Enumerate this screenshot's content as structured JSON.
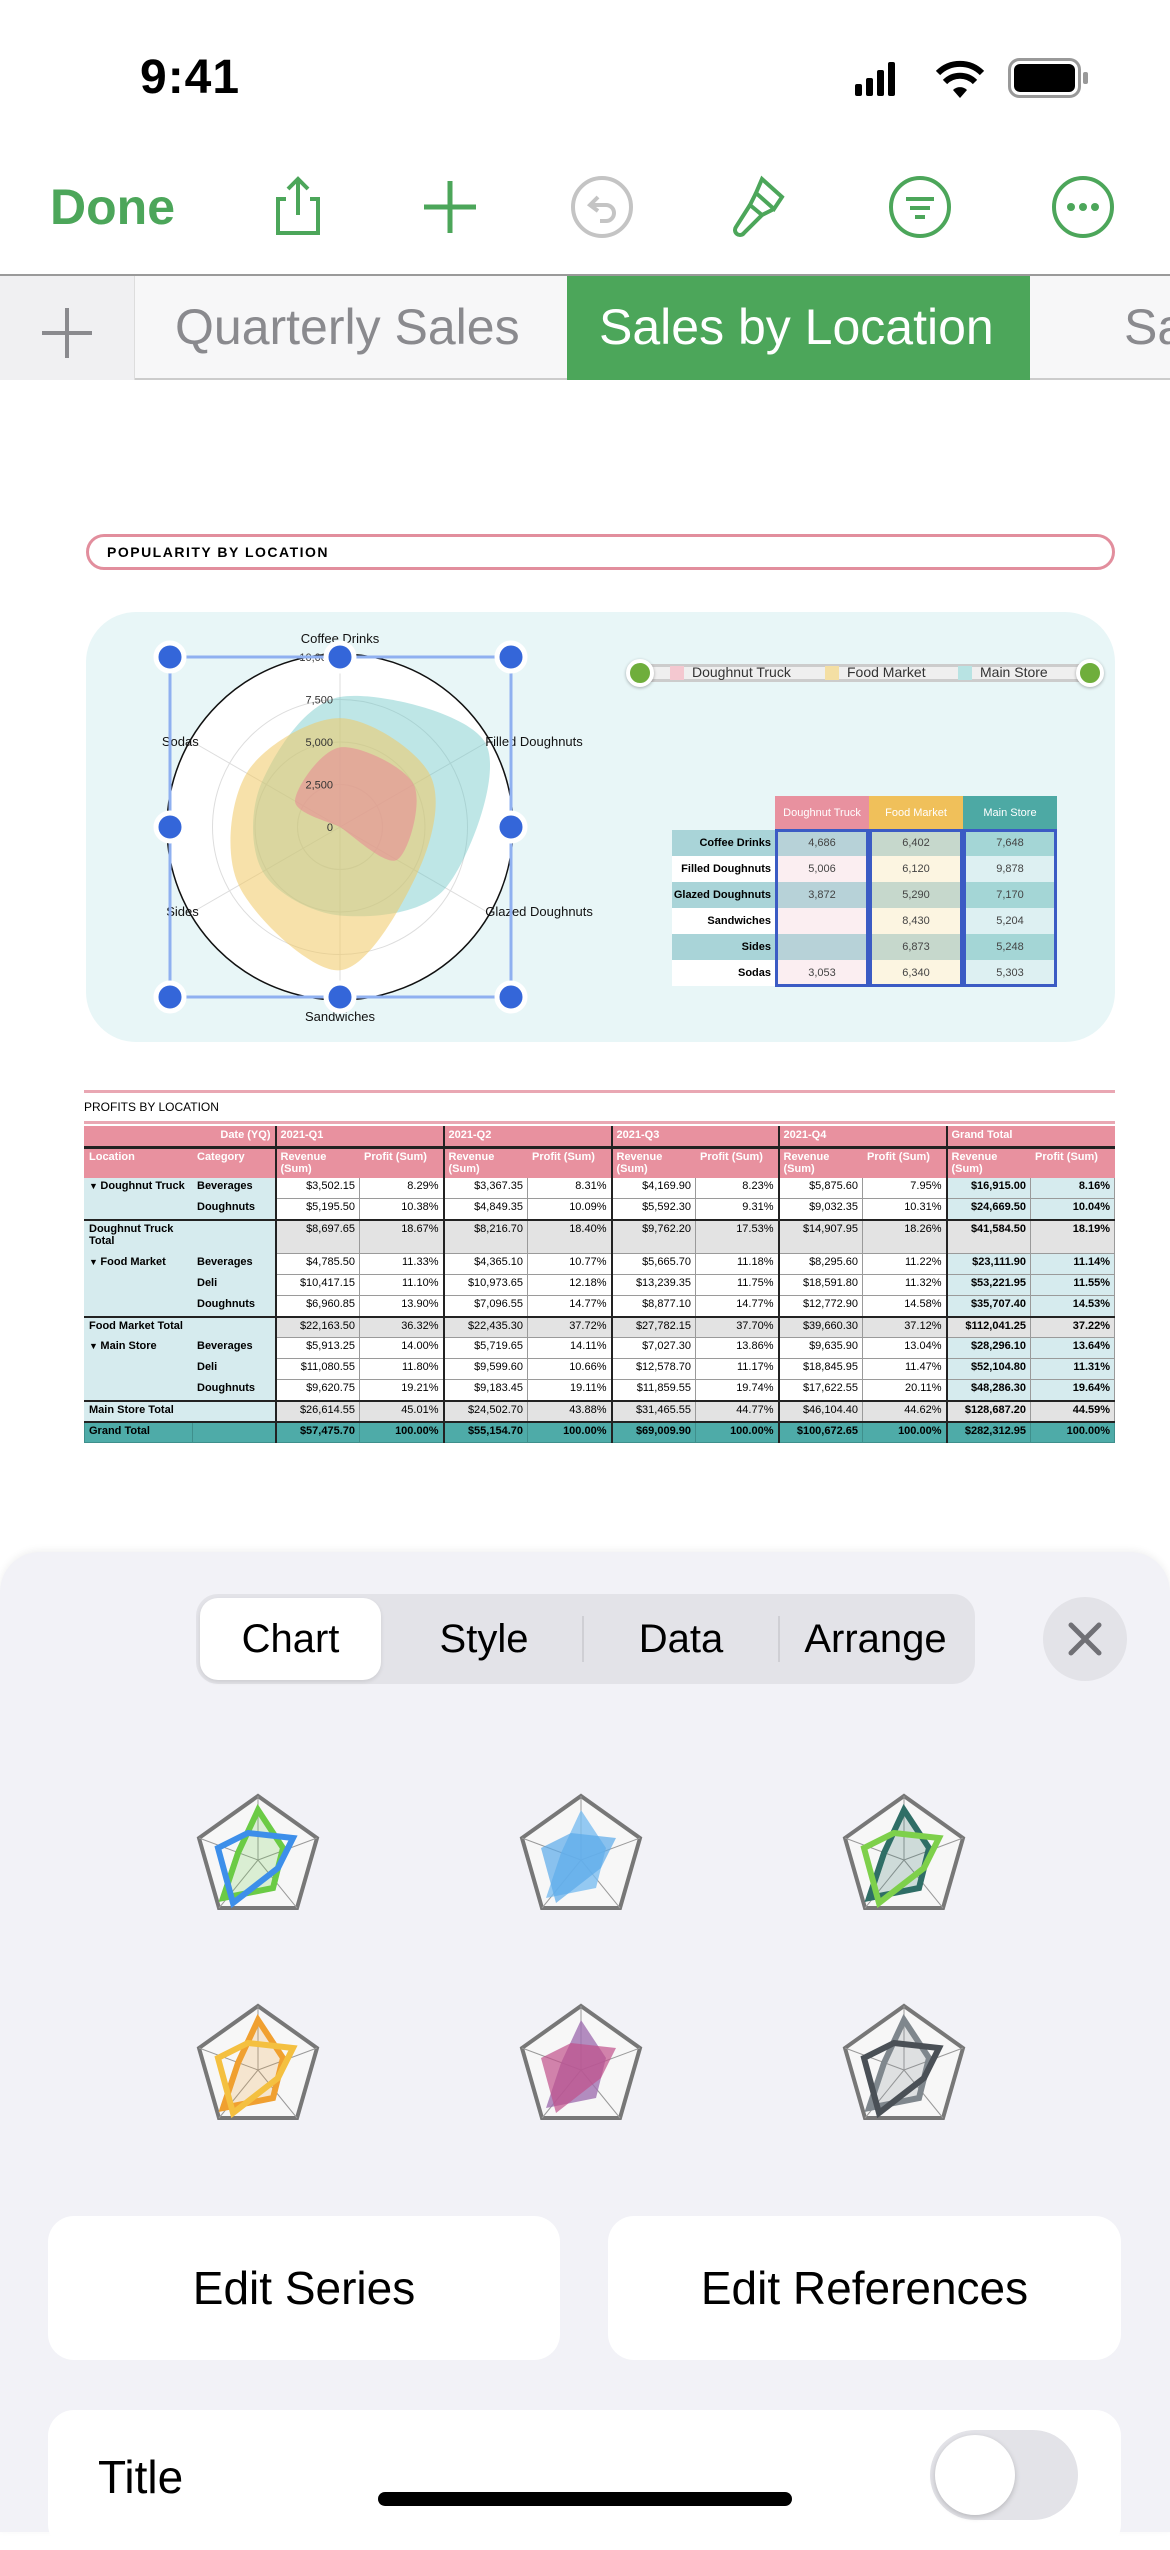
{
  "status_bar": {
    "time": "9:41"
  },
  "toolbar": {
    "done_label": "Done",
    "icons": [
      "share-icon",
      "plus-icon",
      "undo-icon",
      "paintbrush-icon",
      "filter-icon",
      "more-icon"
    ],
    "accent": "#4CA65A"
  },
  "sheet_tabs": {
    "items": [
      {
        "label": "Quarterly Sales",
        "active": false
      },
      {
        "label": "Sales by Location",
        "active": true
      },
      {
        "label": "Sa",
        "active": false
      }
    ]
  },
  "chart_data": {
    "type": "radar",
    "title": "POPULARITY BY LOCATION",
    "categories": [
      "Coffee Drinks",
      "Filled Doughnuts",
      "Glazed Doughnuts",
      "Sandwiches",
      "Sides",
      "Sodas"
    ],
    "series": [
      {
        "name": "Doughnut Truck",
        "color": "#E8919F",
        "values": [
          4686,
          5006,
          3872,
          null,
          null,
          3053
        ]
      },
      {
        "name": "Food Market",
        "color": "#F0C05A",
        "values": [
          6402,
          6120,
          5290,
          8430,
          6873,
          6340
        ]
      },
      {
        "name": "Main Store",
        "color": "#4DA9A4",
        "values": [
          7648,
          9878,
          7170,
          5204,
          5248,
          5303
        ]
      }
    ],
    "radial_ticks": [
      "0",
      "2,500",
      "5,000",
      "7,500",
      "10,000"
    ],
    "range": [
      0,
      10000
    ],
    "legend_position": "top-right",
    "smooth": true
  },
  "mini_table": {
    "headers": [
      "Doughnut Truck",
      "Food Market",
      "Main Store"
    ],
    "rows": [
      {
        "label": "Coffee Drinks",
        "cells": [
          "4,686",
          "6,402",
          "7,648"
        ]
      },
      {
        "label": "Filled Doughnuts",
        "cells": [
          "5,006",
          "6,120",
          "9,878"
        ]
      },
      {
        "label": "Glazed Doughnuts",
        "cells": [
          "3,872",
          "5,290",
          "7,170"
        ]
      },
      {
        "label": "Sandwiches",
        "cells": [
          "",
          "8,430",
          "5,204"
        ]
      },
      {
        "label": "Sides",
        "cells": [
          "",
          "6,873",
          "5,248"
        ]
      },
      {
        "label": "Sodas",
        "cells": [
          "3,053",
          "6,340",
          "5,303"
        ]
      }
    ]
  },
  "profits": {
    "title": "PROFITS BY LOCATION",
    "date_label": "Date (YQ)",
    "periods": [
      "2021-Q1",
      "2021-Q2",
      "2021-Q3",
      "2021-Q4",
      "Grand Total"
    ],
    "location_header": "Location",
    "category_header": "Category",
    "revenue_header": "Revenue (Sum)",
    "profit_header": "Profit (Sum)",
    "rows": [
      {
        "type": "data",
        "location": "Doughnut Truck",
        "expand": true,
        "category": "Beverages",
        "values": [
          "$3,502.15",
          "8.29%",
          "$3,367.35",
          "8.31%",
          "$4,169.90",
          "8.23%",
          "$5,875.60",
          "7.95%",
          "$16,915.00",
          "8.16%"
        ]
      },
      {
        "type": "data",
        "location": "",
        "category": "Doughnuts",
        "values": [
          "$5,195.50",
          "10.38%",
          "$4,849.35",
          "10.09%",
          "$5,592.30",
          "9.31%",
          "$9,032.35",
          "10.31%",
          "$24,669.50",
          "10.04%"
        ]
      },
      {
        "type": "total",
        "location": "Doughnut Truck Total",
        "category": "",
        "values": [
          "$8,697.65",
          "18.67%",
          "$8,216.70",
          "18.40%",
          "$9,762.20",
          "17.53%",
          "$14,907.95",
          "18.26%",
          "$41,584.50",
          "18.19%"
        ]
      },
      {
        "type": "data",
        "location": "Food Market",
        "expand": true,
        "category": "Beverages",
        "values": [
          "$4,785.50",
          "11.33%",
          "$4,365.10",
          "10.77%",
          "$5,665.70",
          "11.18%",
          "$8,295.60",
          "11.22%",
          "$23,111.90",
          "11.14%"
        ]
      },
      {
        "type": "data",
        "location": "",
        "category": "Deli",
        "values": [
          "$10,417.15",
          "11.10%",
          "$10,973.65",
          "12.18%",
          "$13,239.35",
          "11.75%",
          "$18,591.80",
          "11.32%",
          "$53,221.95",
          "11.55%"
        ]
      },
      {
        "type": "data",
        "location": "",
        "category": "Doughnuts",
        "values": [
          "$6,960.85",
          "13.90%",
          "$7,096.55",
          "14.77%",
          "$8,877.10",
          "14.77%",
          "$12,772.90",
          "14.58%",
          "$35,707.40",
          "14.53%"
        ]
      },
      {
        "type": "total",
        "location": "Food Market Total",
        "category": "",
        "values": [
          "$22,163.50",
          "36.32%",
          "$22,435.30",
          "37.72%",
          "$27,782.15",
          "37.70%",
          "$39,660.30",
          "37.12%",
          "$112,041.25",
          "37.22%"
        ]
      },
      {
        "type": "data",
        "location": "Main Store",
        "expand": true,
        "category": "Beverages",
        "values": [
          "$5,913.25",
          "14.00%",
          "$5,719.65",
          "14.11%",
          "$7,027.30",
          "13.86%",
          "$9,635.90",
          "13.04%",
          "$28,296.10",
          "13.64%"
        ]
      },
      {
        "type": "data",
        "location": "",
        "category": "Deli",
        "values": [
          "$11,080.55",
          "11.80%",
          "$9,599.60",
          "10.66%",
          "$12,578.70",
          "11.17%",
          "$18,845.95",
          "11.47%",
          "$52,104.80",
          "11.31%"
        ]
      },
      {
        "type": "data",
        "location": "",
        "category": "Doughnuts",
        "values": [
          "$9,620.75",
          "19.21%",
          "$9,183.45",
          "19.11%",
          "$11,859.55",
          "19.74%",
          "$17,622.55",
          "20.11%",
          "$48,286.30",
          "19.64%"
        ]
      },
      {
        "type": "total",
        "location": "Main Store Total",
        "category": "",
        "values": [
          "$26,614.55",
          "45.01%",
          "$24,502.70",
          "43.88%",
          "$31,465.55",
          "44.77%",
          "$46,104.40",
          "44.62%",
          "$128,687.20",
          "44.59%"
        ]
      },
      {
        "type": "grand",
        "location": "Grand Total",
        "category": "",
        "values": [
          "$57,475.70",
          "100.00%",
          "$55,154.70",
          "100.00%",
          "$69,009.90",
          "100.00%",
          "$100,672.65",
          "100.00%",
          "$282,312.95",
          "100.00%"
        ]
      }
    ]
  },
  "format_panel": {
    "tabs": [
      {
        "label": "Chart",
        "active": true
      },
      {
        "label": "Style",
        "active": false
      },
      {
        "label": "Data",
        "active": false
      },
      {
        "label": "Arrange",
        "active": false
      }
    ],
    "close_icon": "close-icon",
    "style_presets": [
      {
        "colors": [
          "#6BCB45",
          "#3D8FEA"
        ]
      },
      {
        "colors": [
          "#7ABDF0",
          "#5AA9EA"
        ]
      },
      {
        "colors": [
          "#2F6E66",
          "#7ED04B"
        ]
      },
      {
        "colors": [
          "#F0A030",
          "#F4C040"
        ]
      },
      {
        "colors": [
          "#A070B0",
          "#C0508A"
        ]
      },
      {
        "colors": [
          "#7F878D",
          "#4A5056"
        ]
      }
    ],
    "edit_series_label": "Edit Series",
    "edit_references_label": "Edit References",
    "title_label": "Title",
    "title_toggle_on": false
  }
}
